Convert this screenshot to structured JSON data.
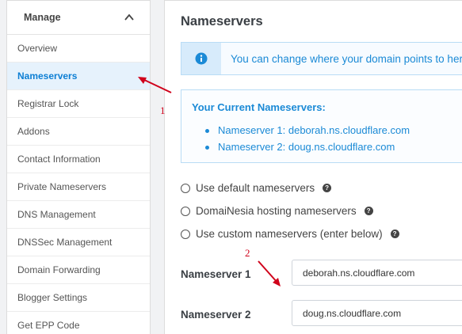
{
  "sidebar": {
    "title": "Manage",
    "items": [
      {
        "label": "Overview",
        "active": false
      },
      {
        "label": "Nameservers",
        "active": true
      },
      {
        "label": "Registrar Lock",
        "active": false
      },
      {
        "label": "Addons",
        "active": false
      },
      {
        "label": "Contact Information",
        "active": false
      },
      {
        "label": "Private Nameservers",
        "active": false
      },
      {
        "label": "DNS Management",
        "active": false
      },
      {
        "label": "DNSSec Management",
        "active": false
      },
      {
        "label": "Domain Forwarding",
        "active": false
      },
      {
        "label": "Blogger Settings",
        "active": false
      },
      {
        "label": "Get EPP Code",
        "active": false
      }
    ]
  },
  "main": {
    "title": "Nameservers",
    "info_message": "You can change where your domain points to here.",
    "current": {
      "heading": "Your Current Nameservers:",
      "items": [
        "Nameserver 1: deborah.ns.cloudflare.com",
        "Nameserver 2: doug.ns.cloudflare.com"
      ]
    },
    "options": [
      "Use default nameservers",
      "DomaiNesia hosting nameservers",
      "Use custom nameservers (enter below)"
    ],
    "help_glyph": "?",
    "fields": [
      {
        "label": "Nameserver 1",
        "value": "deborah.ns.cloudflare.com"
      },
      {
        "label": "Nameserver 2",
        "value": "doug.ns.cloudflare.com"
      }
    ]
  },
  "annotations": {
    "label_1": "1",
    "label_2": "2",
    "color": "#d0021b"
  },
  "colors": {
    "accent": "#1b8ad6",
    "active_bg": "#e6f2fc"
  }
}
